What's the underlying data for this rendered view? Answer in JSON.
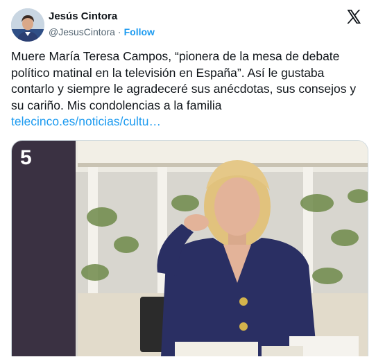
{
  "author": {
    "display_name": "Jesús Cintora",
    "handle": "@JesusCintora",
    "separator": "·",
    "follow_label": "Follow"
  },
  "tweet": {
    "text": "Muere María Teresa Campos, “pionera de la mesa de debate político matinal en la televisión en España”. Así le gustaba contarlo y siempre le agradeceré sus anécdotas, sus consejos y su cariño. Mis condolencias a la familia",
    "link_text": "telecinco.es/noticias/cultu…"
  },
  "media": {
    "channel_logo_text": "5"
  },
  "icons": {
    "platform": "x-logo-icon"
  },
  "colors": {
    "link": "#1d9bf0",
    "text": "#0f1419",
    "secondary": "#536471",
    "jacket": "#2a2f63"
  }
}
